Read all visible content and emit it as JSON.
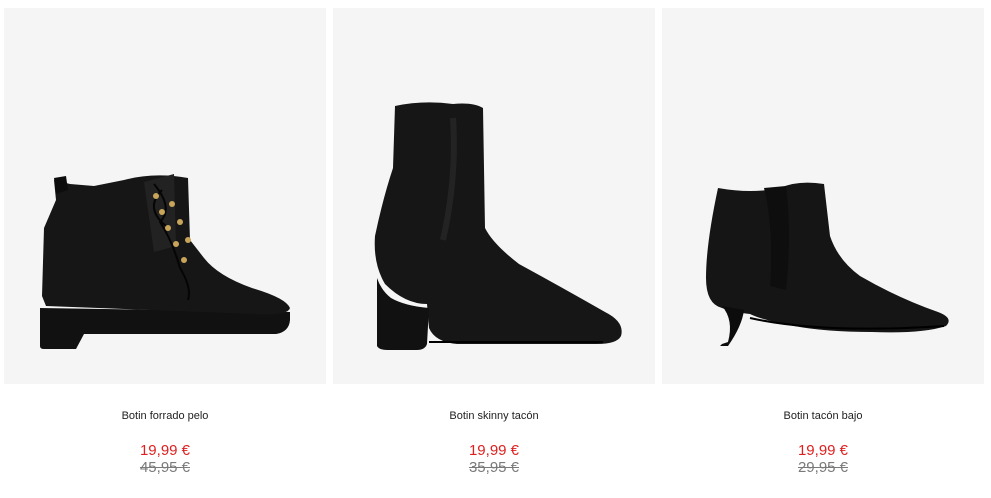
{
  "colors": {
    "sale_price": "#e02020",
    "old_price": "#7a7a7a",
    "image_background": "#f5f5f5",
    "product_name": "#222222"
  },
  "products": [
    {
      "name": "Botin forrado pelo",
      "sale_price": "19,99 €",
      "old_price": "45,95 €",
      "image": "black-lace-up-ankle-boot"
    },
    {
      "name": "Botin skinny tacón",
      "sale_price": "19,99 €",
      "old_price": "35,95 €",
      "image": "black-sock-block-heel-boot"
    },
    {
      "name": "Botin tacón bajo",
      "sale_price": "19,99 €",
      "old_price": "29,95 €",
      "image": "black-kitten-heel-chelsea-boot"
    }
  ]
}
